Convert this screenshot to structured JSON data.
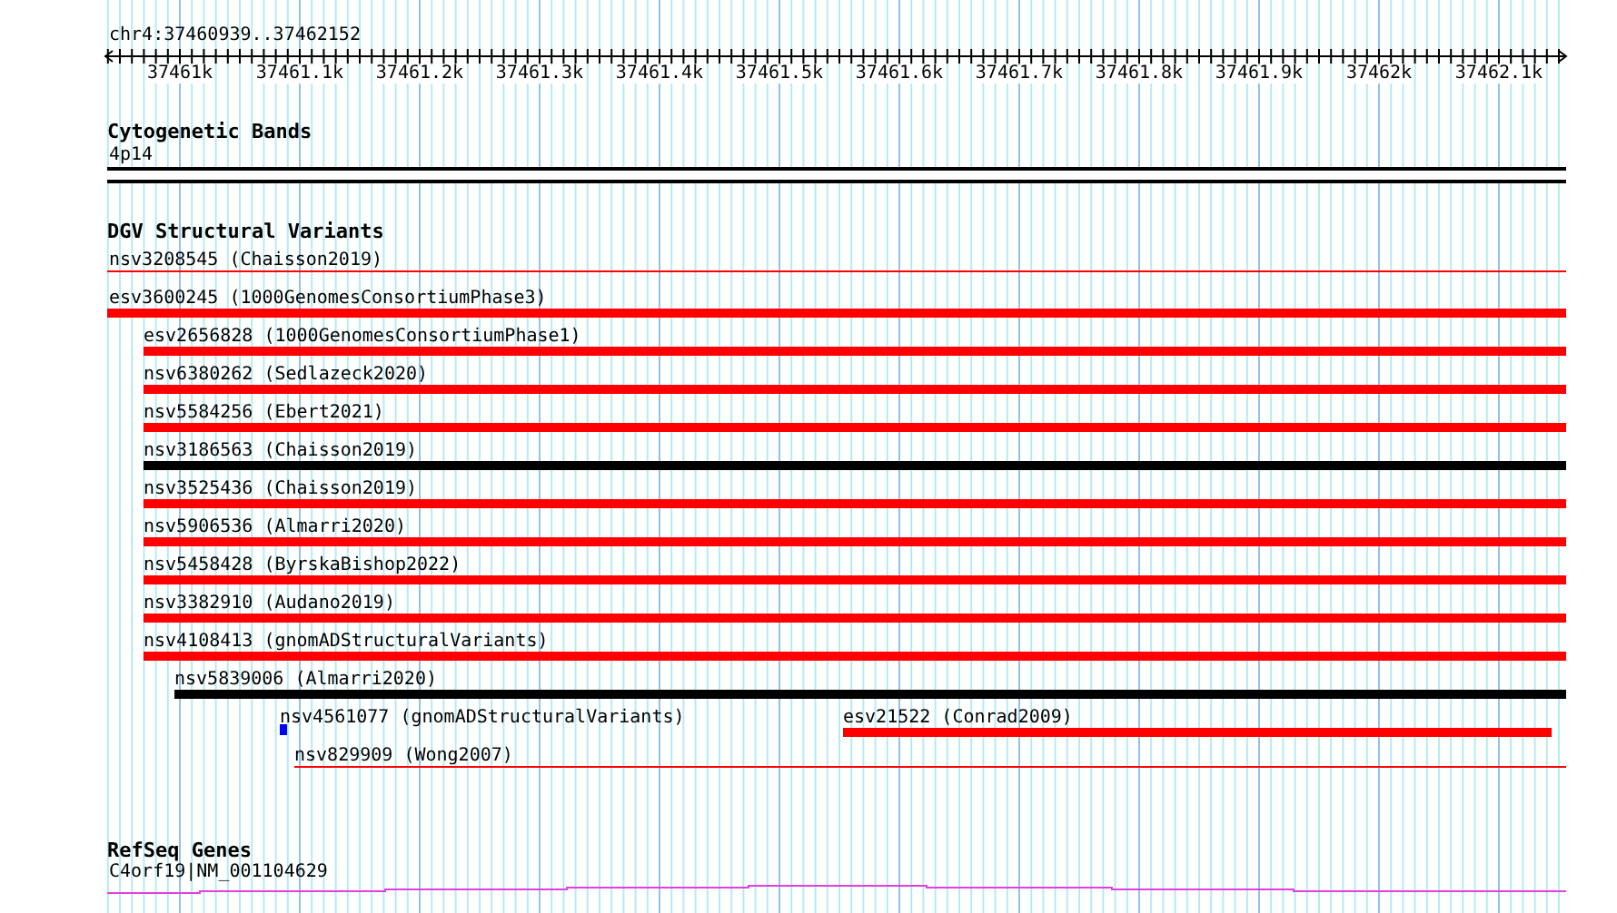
{
  "ruler": {
    "location": "chr4:37460939..37462152",
    "ticks": [
      "37461k",
      "37461.1k",
      "37461.2k",
      "37461.3k",
      "37461.4k",
      "37461.5k",
      "37461.6k",
      "37461.7k",
      "37461.8k",
      "37461.9k",
      "37462k",
      "37462.1k"
    ]
  },
  "cytogenetic_bands": {
    "title": "Cytogenetic Bands",
    "band": "4p14"
  },
  "dgv": {
    "title": "DGV Structural Variants",
    "variants": [
      {
        "label": "nsv3208545 (Chaisson2019)",
        "kind": "line",
        "color": "#ff0000"
      },
      {
        "label": "esv3600245 (1000GenomesConsortiumPhase3)",
        "kind": "bar",
        "color": "#ff0000"
      },
      {
        "label": "esv2656828 (1000GenomesConsortiumPhase1)",
        "kind": "bar",
        "color": "#ff0000"
      },
      {
        "label": "nsv6380262 (Sedlazeck2020)",
        "kind": "bar",
        "color": "#ff0000"
      },
      {
        "label": "nsv5584256 (Ebert2021)",
        "kind": "bar",
        "color": "#ff0000"
      },
      {
        "label": "nsv3186563 (Chaisson2019)",
        "kind": "bar",
        "color": "#000000"
      },
      {
        "label": "nsv3525436 (Chaisson2019)",
        "kind": "bar",
        "color": "#ff0000"
      },
      {
        "label": "nsv5906536 (Almarri2020)",
        "kind": "bar",
        "color": "#ff0000"
      },
      {
        "label": "nsv5458428 (ByrskaBishop2022)",
        "kind": "bar",
        "color": "#ff0000"
      },
      {
        "label": "nsv3382910 (Audano2019)",
        "kind": "bar",
        "color": "#ff0000"
      },
      {
        "label": "nsv4108413 (gnomADStructuralVariants)",
        "kind": "bar",
        "color": "#ff0000"
      },
      {
        "label": "nsv5839006 (Almarri2020)",
        "kind": "bar",
        "color": "#000000"
      },
      {
        "label": "nsv4561077 (gnomADStructuralVariants)",
        "kind": "block",
        "color": "#0000ff"
      },
      {
        "label": "esv21522 (Conrad2009)",
        "kind": "bar",
        "color": "#ff0000"
      },
      {
        "label": "nsv829909 (Wong2007)",
        "kind": "line",
        "color": "#ff0000"
      }
    ]
  },
  "refseq": {
    "title": "RefSeq Genes",
    "gene": "C4orf19|NM_001104629"
  }
}
